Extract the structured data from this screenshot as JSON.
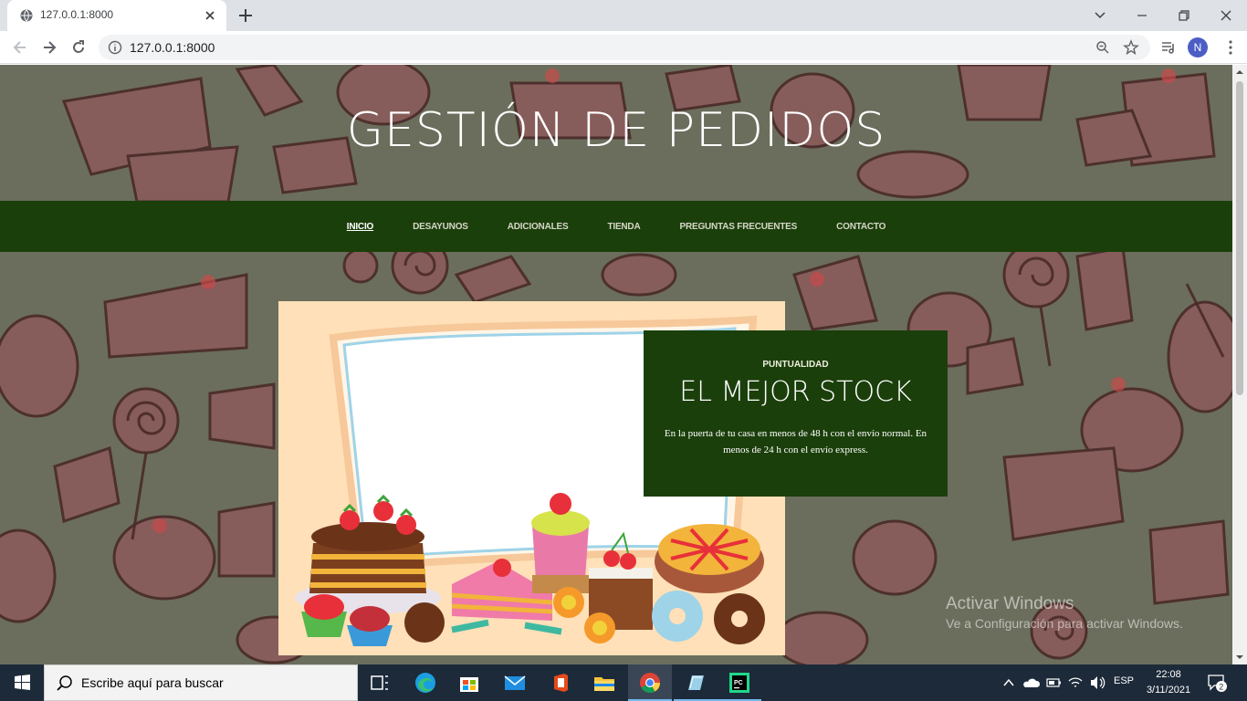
{
  "browser": {
    "tab_title": "127.0.0.1:8000",
    "url": "127.0.0.1:8000",
    "avatar_letter": "N"
  },
  "site": {
    "title": "GESTIÓN DE PEDIDOS",
    "nav": [
      {
        "label": "INICIO",
        "active": true
      },
      {
        "label": "DESAYUNOS"
      },
      {
        "label": "ADICIONALES"
      },
      {
        "label": "TIENDA"
      },
      {
        "label": "PREGUNTAS FRECUENTES"
      },
      {
        "label": "CONTACTO"
      }
    ],
    "promo": {
      "kicker": "PUNTUALIDAD",
      "title": "EL MEJOR STOCK",
      "text": "En la puerta de tu casa en menos de 48 h con el envío normal. En menos de 24 h con el envío express."
    },
    "colors": {
      "nav_bg": "#1b3f0b",
      "page_bg": "#6b6e5c",
      "hero_bg": "#ffe0b8"
    }
  },
  "windows_watermark": {
    "title": "Activar Windows",
    "subtitle": "Ve a Configuración para activar Windows."
  },
  "taskbar": {
    "search_placeholder": "Escribe aquí para buscar",
    "language": "ESP",
    "time": "22:08",
    "date": "3/11/2021",
    "notification_count": "2"
  }
}
